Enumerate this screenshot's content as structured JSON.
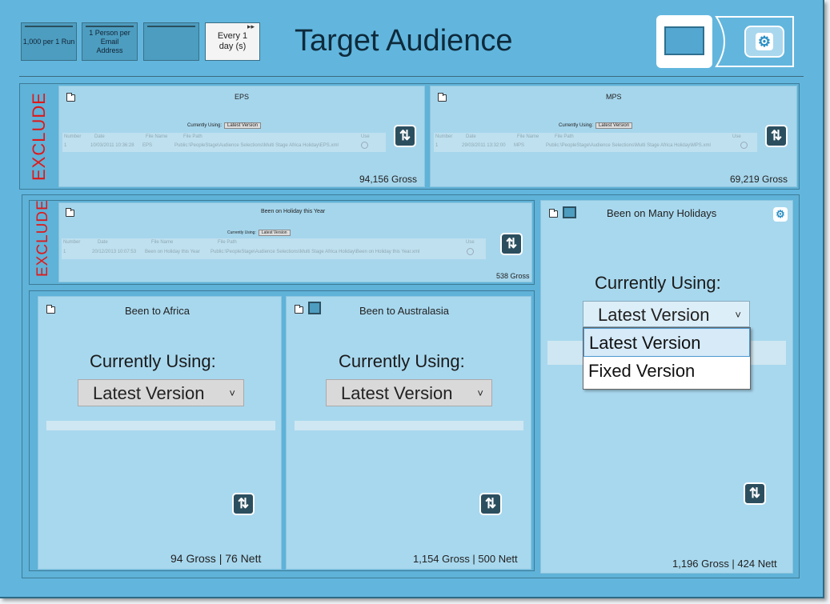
{
  "header": {
    "box1": "1,000 per 1 Run",
    "box2": "1 Person per Email Address",
    "box3": "",
    "box4": "Every 1 day (s)",
    "title": "Target Audience"
  },
  "exclude_label": "EXCLUDE",
  "currently_using_small": "Currently Using:",
  "latest_small": "Latest Version",
  "columns": {
    "number": "Number",
    "date": "Date",
    "file_name": "File Name",
    "file_path": "File Path",
    "use": "Use"
  },
  "eps": {
    "title": "EPS",
    "row_number": "1",
    "row_date": "10/03/2011 10:36:28",
    "row_name": "EPS",
    "row_path": "Public:\\PeopleStage\\Audience Selections\\Multi Stage Africa Holiday\\EPS.xml",
    "count": "94,156 Gross"
  },
  "mps": {
    "title": "MPS",
    "row_number": "1",
    "row_date": "29/03/2011 13:32:00",
    "row_name": "MPS",
    "row_path": "Public:\\PeopleStage\\Audience Selections\\Multi Stage Africa Holiday\\MPS.xml",
    "count": "69,219 Gross"
  },
  "holiday_year": {
    "title": "Been on Holiday this Year",
    "row_number": "1",
    "row_date": "20/12/2013 10:07:53",
    "row_name": "Been on Holiday this Year",
    "row_path": "Public:\\PeopleStage\\Audience Selections\\Multi Stage Africa Holiday\\Been on Holiday this Year.xml",
    "count": "538 Gross"
  },
  "africa": {
    "title": "Been to Africa",
    "currently_using": "Currently Using:",
    "version": "Latest Version",
    "count": "94 Gross | 76 Nett"
  },
  "australasia": {
    "title": "Been to Australasia",
    "currently_using": "Currently Using:",
    "version": "Latest Version",
    "count": "1,154 Gross | 500 Nett"
  },
  "many_holidays": {
    "title": "Been on Many Holidays",
    "currently_using": "Currently Using:",
    "version": "Latest Version",
    "options": [
      "Latest Version",
      "Fixed Version"
    ],
    "count": "1,196 Gross | 424 Nett"
  },
  "icons": {
    "refresh": "⇅",
    "chevron": "˅",
    "gear": "⚙"
  }
}
